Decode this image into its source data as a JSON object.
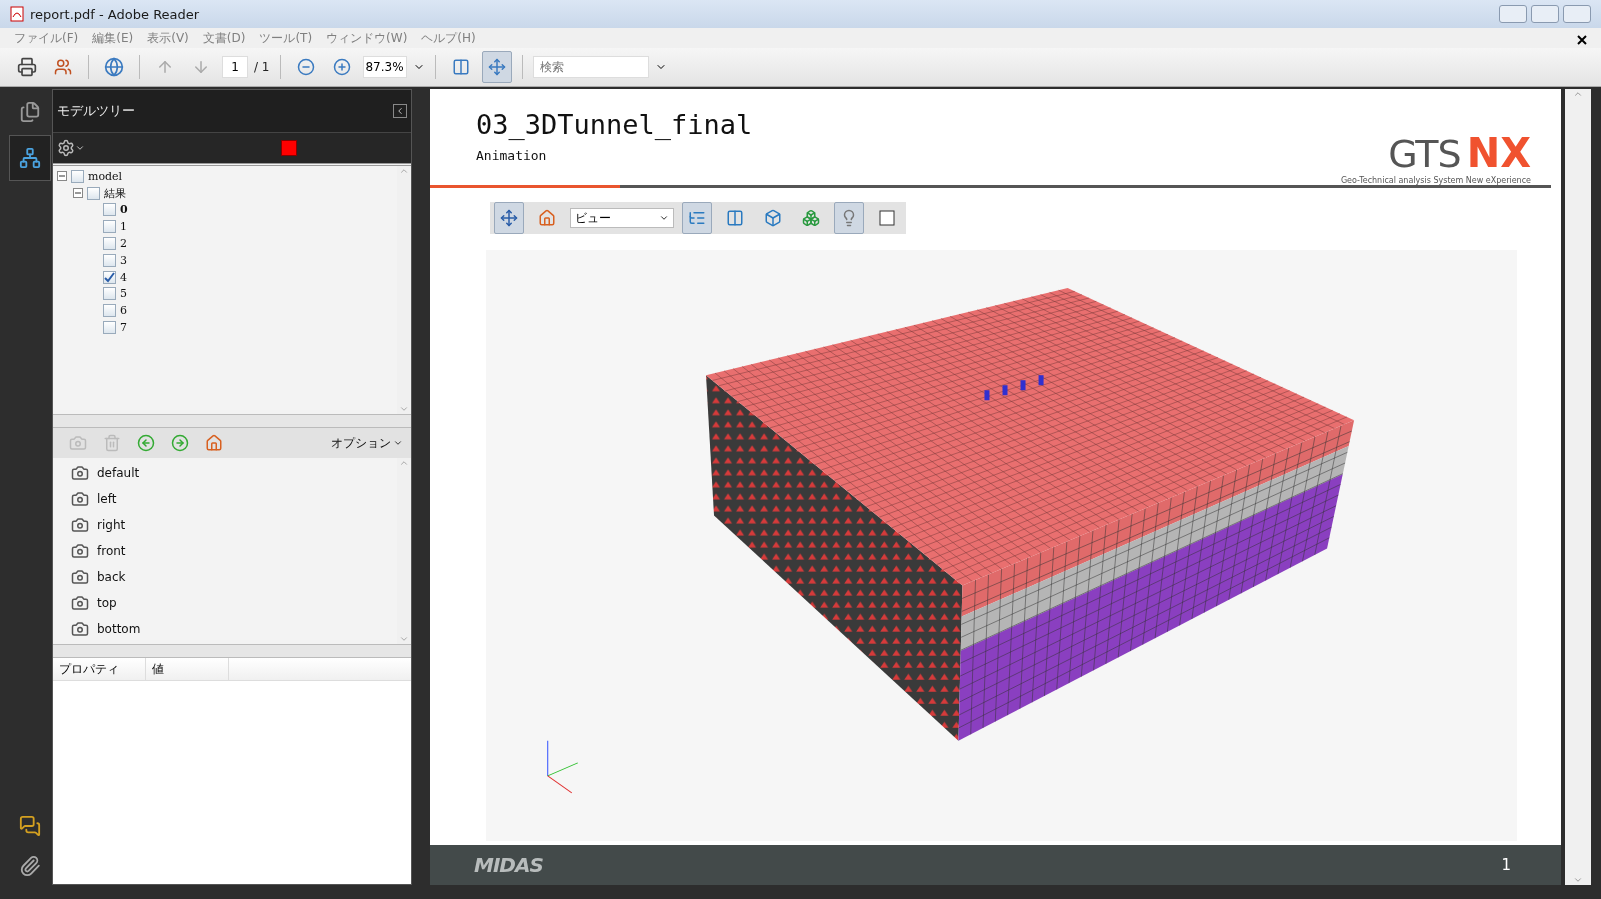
{
  "window": {
    "title": "report.pdf - Adobe Reader"
  },
  "menu": [
    "ファイル(F)",
    "編集(E)",
    "表示(V)",
    "文書(D)",
    "ツール(T)",
    "ウィンドウ(W)",
    "ヘルプ(H)"
  ],
  "toolbar": {
    "page": "1",
    "page_count": "/ 1",
    "zoom": "87.3%",
    "search_placeholder": "検索",
    "fit_width_pressed": false,
    "fit_page_pressed": true
  },
  "rail": [
    {
      "kind": "pages",
      "selected": false
    },
    {
      "kind": "model_tree",
      "selected": true
    }
  ],
  "panel": {
    "title": "モデルツリー",
    "tree": [
      {
        "label": "model",
        "checked": false,
        "expanded": true,
        "selected": false,
        "children": [
          {
            "label": "結果",
            "checked": false,
            "expanded": true,
            "selected": false,
            "children": [
              {
                "label": "0",
                "checked": false,
                "selected": true
              },
              {
                "label": "1",
                "checked": false,
                "selected": false
              },
              {
                "label": "2",
                "checked": false,
                "selected": false
              },
              {
                "label": "3",
                "checked": false,
                "selected": false
              },
              {
                "label": "4",
                "checked": true,
                "selected": false
              },
              {
                "label": "5",
                "checked": false,
                "selected": false
              },
              {
                "label": "6",
                "checked": false,
                "selected": false
              },
              {
                "label": "7",
                "checked": false,
                "selected": false
              }
            ]
          }
        ]
      }
    ],
    "options_label": "オプション",
    "views": [
      "default",
      "left",
      "right",
      "front",
      "back",
      "top",
      "bottom"
    ],
    "property_columns": [
      "プロパティ",
      "値"
    ]
  },
  "document": {
    "title": "03_3DTunnel_final",
    "subtitle": "Animation",
    "logo": {
      "left": "GTS",
      "right": "NX",
      "tagline": "Geo-Technical analysis System New eXperience"
    },
    "view_toolbar": {
      "view": "ビュー",
      "navigate_pressed": true,
      "tree_pressed": true,
      "light_pressed": true
    },
    "footer": {
      "brand": "MIDAS",
      "page_number": "1"
    }
  }
}
